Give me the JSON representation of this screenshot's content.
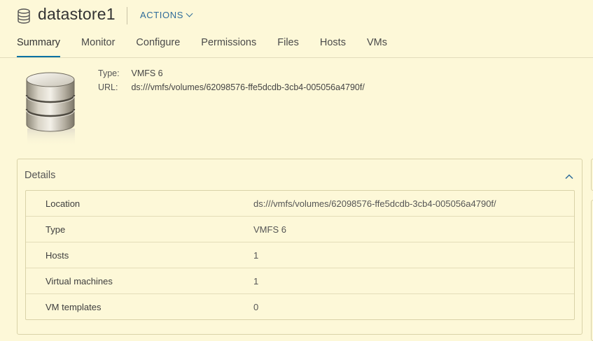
{
  "header": {
    "title": "datastore1",
    "actions_label": "ACTIONS",
    "icon": "datastore-icon"
  },
  "tabs": [
    {
      "label": "Summary",
      "active": true
    },
    {
      "label": "Monitor",
      "active": false
    },
    {
      "label": "Configure",
      "active": false
    },
    {
      "label": "Permissions",
      "active": false
    },
    {
      "label": "Files",
      "active": false
    },
    {
      "label": "Hosts",
      "active": false
    },
    {
      "label": "VMs",
      "active": false
    }
  ],
  "summary": {
    "type_label": "Type:",
    "type_value": "VMFS 6",
    "url_label": "URL:",
    "url_value": "ds:///vmfs/volumes/62098576-ffe5dcdb-3cb4-005056a4790f/"
  },
  "details": {
    "title": "Details",
    "rows": [
      {
        "label": "Location",
        "value": "ds:///vmfs/volumes/62098576-ffe5dcdb-3cb4-005056a4790f/"
      },
      {
        "label": "Type",
        "value": "VMFS 6"
      },
      {
        "label": "Hosts",
        "value": "1"
      },
      {
        "label": "Virtual machines",
        "value": "1"
      },
      {
        "label": "VM templates",
        "value": "0"
      }
    ]
  },
  "colors": {
    "background": "#fdf8d8",
    "accent": "#0072a3",
    "link": "#2f6c9a"
  }
}
